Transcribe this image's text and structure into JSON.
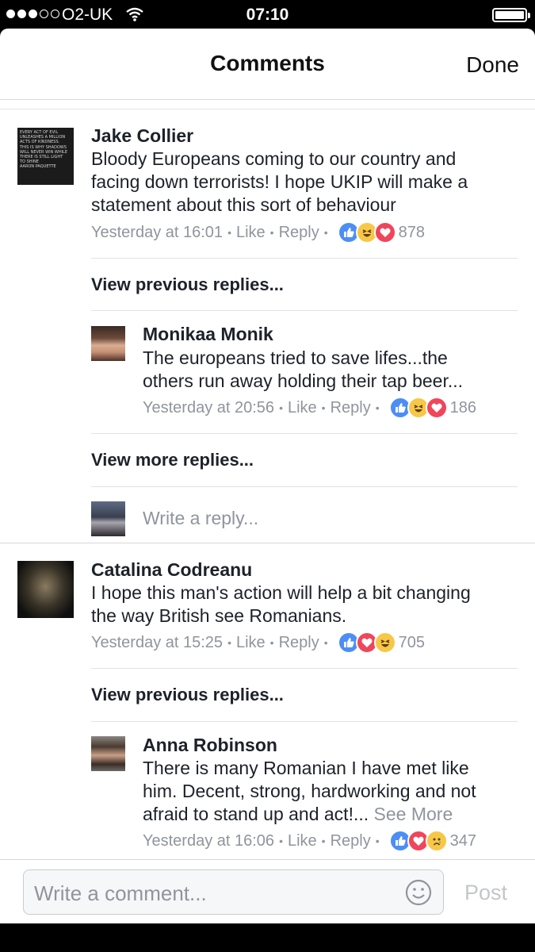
{
  "status_bar": {
    "carrier": "O2-UK",
    "time": "07:10"
  },
  "header": {
    "title": "Comments",
    "done_label": "Done"
  },
  "comments": [
    {
      "author": "Jake Collier",
      "avatar_text": [
        "EVERY ACT OF EVIL",
        "UNLEASHES A MILLION",
        "ACTS OF KINDNESS.",
        "THIS IS WHY SHADOWS",
        "WILL NEVER WIN WHILE",
        "THERE IS STILL LIGHT",
        "TO SHINE",
        "AARON PAQUETTE"
      ],
      "text_lines": [
        "Bloody Europeans coming to our country and",
        "facing down terrorists! I hope UKIP will make a",
        "statement about this sort of behaviour"
      ],
      "time": "Yesterday at 16:01",
      "like_label": "Like",
      "reply_label": "Reply",
      "reactions": [
        "like",
        "haha",
        "love"
      ],
      "reaction_count": "878",
      "view_replies_label": "View previous replies...",
      "reply": {
        "author": "Monikaa Monik",
        "text_lines": [
          "The europeans tried to save lifes...the",
          "others run away holding their tap beer..."
        ],
        "time": "Yesterday at 20:56",
        "like_label": "Like",
        "reply_label": "Reply",
        "reactions": [
          "like",
          "haha",
          "love"
        ],
        "reaction_count": "186"
      },
      "view_more_label": "View more replies...",
      "write_reply_placeholder": "Write a reply..."
    },
    {
      "author": "Catalina Codreanu",
      "text_lines": [
        "I hope this man's action will help a bit changing",
        "the way British see Romanians."
      ],
      "time": "Yesterday at 15:25",
      "like_label": "Like",
      "reply_label": "Reply",
      "reactions": [
        "like",
        "love",
        "haha"
      ],
      "reaction_count": "705",
      "view_replies_label": "View previous replies...",
      "reply": {
        "author": "Anna Robinson",
        "text_lines": [
          "There is many Romanian I have met like",
          "him. Decent, strong, hardworking and not",
          "afraid to stand up and act!..."
        ],
        "see_more_label": "See More",
        "time": "Yesterday at 16:06",
        "like_label": "Like",
        "reply_label": "Reply",
        "reactions": [
          "like",
          "love",
          "sad"
        ],
        "reaction_count": "347"
      }
    }
  ],
  "composer": {
    "placeholder": "Write a comment...",
    "post_label": "Post"
  },
  "icons": {
    "signal": "signal-dots-icon",
    "wifi": "wifi-icon",
    "battery": "battery-icon",
    "reaction_like": "thumbs-up-icon",
    "reaction_love": "heart-icon",
    "reaction_haha": "laughing-face-icon",
    "reaction_sad": "crying-face-icon",
    "smiley": "smiley-icon"
  },
  "colors": {
    "accent_blue": "#4c8ef6",
    "love_red": "#f0455b",
    "haha_yellow": "#f7c747",
    "meta_gray": "#90949c"
  }
}
